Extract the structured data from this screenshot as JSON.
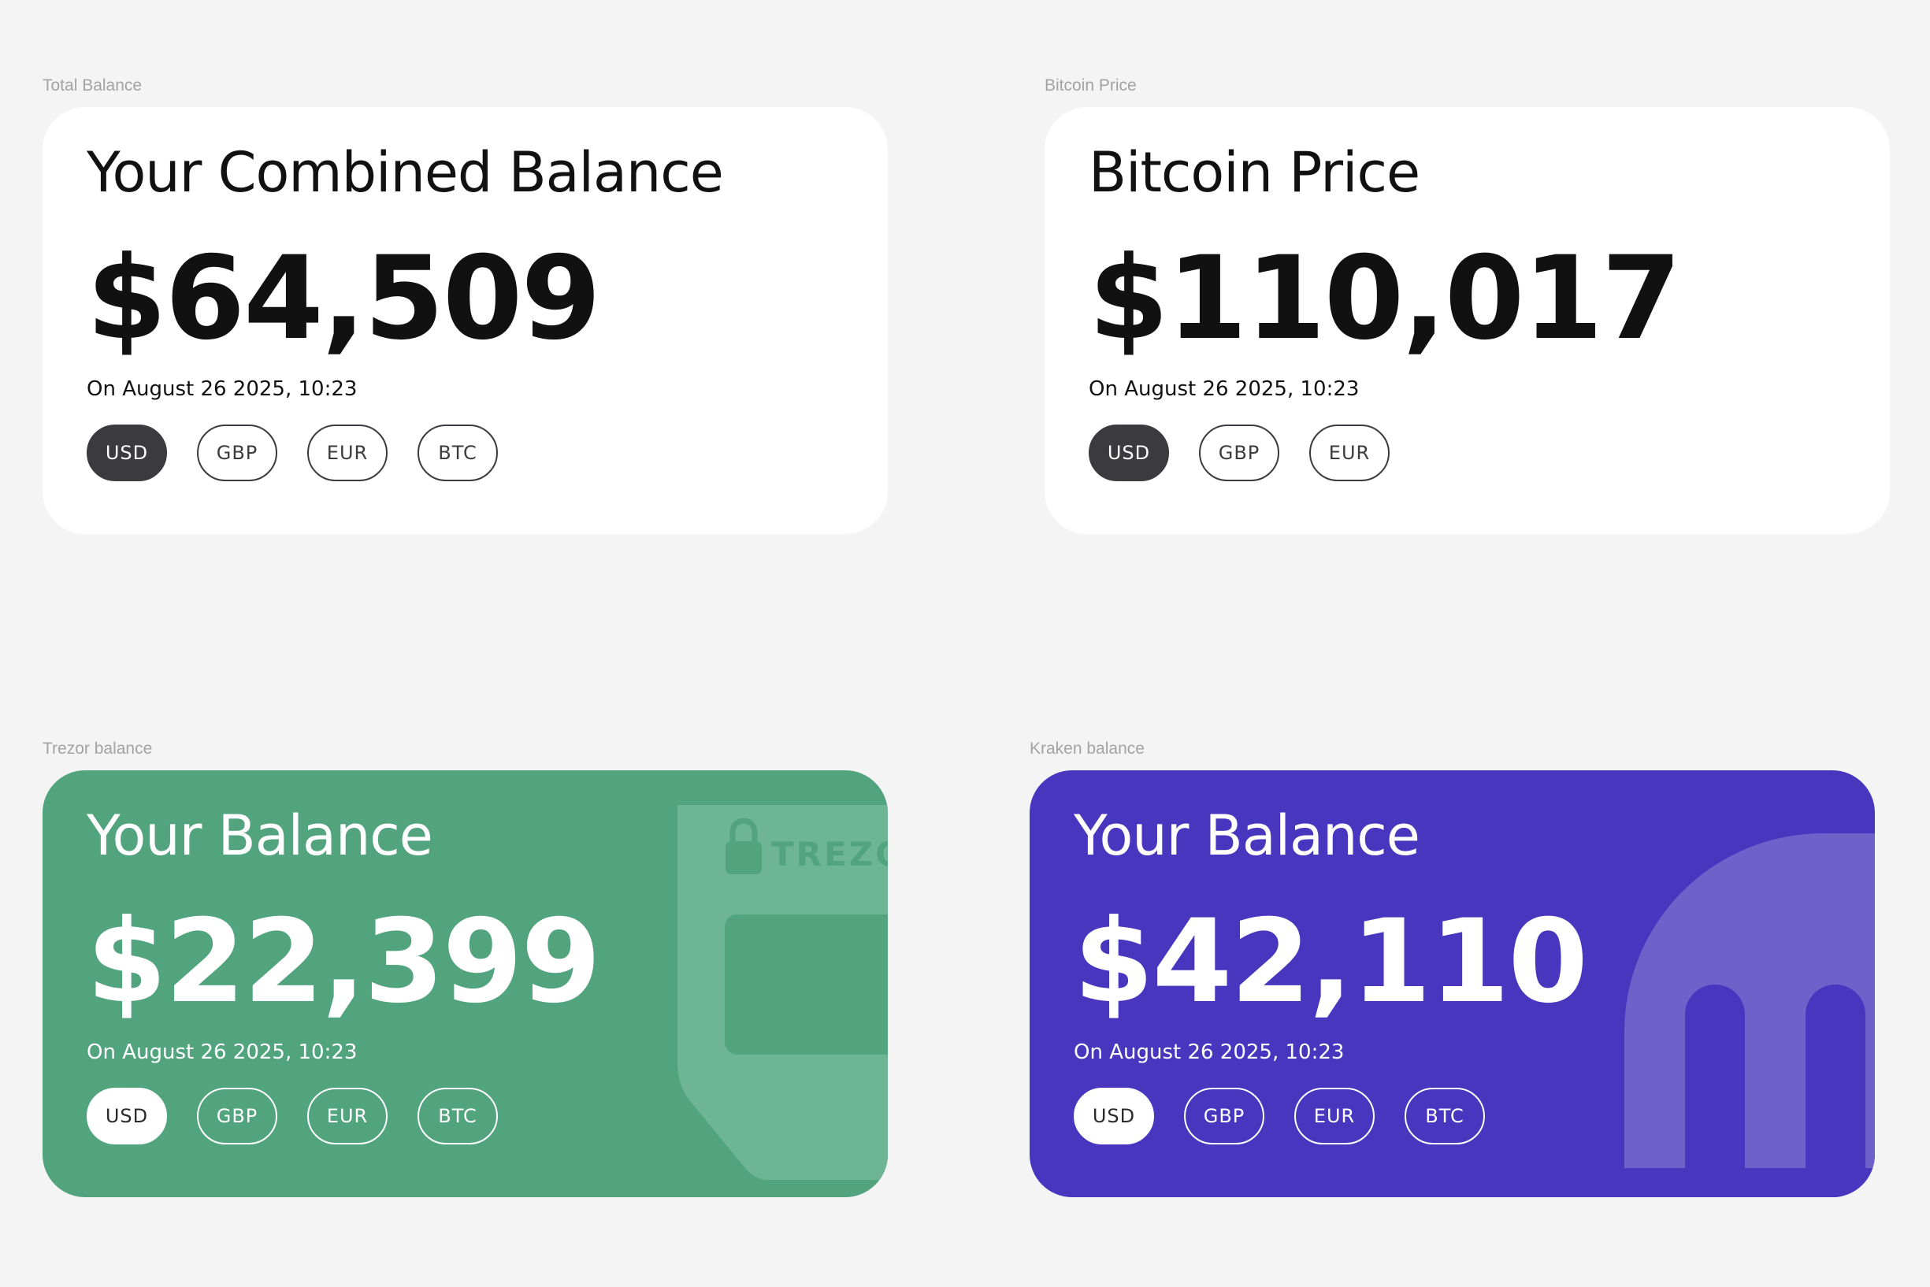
{
  "widgets": [
    {
      "caption": "Total Balance",
      "title": "Your Combined Balance",
      "amount": "$64,509",
      "date": "On August 26 2025, 10:23",
      "currencies": [
        "USD",
        "GBP",
        "EUR",
        "BTC"
      ],
      "selected_currency": "USD",
      "theme": "white",
      "background": "#ffffff"
    },
    {
      "caption": "Bitcoin Price",
      "title": "Bitcoin Price",
      "amount": "$110,017",
      "date": "On August 26 2025, 10:23",
      "currencies": [
        "USD",
        "GBP",
        "EUR"
      ],
      "selected_currency": "USD",
      "theme": "white",
      "background": "#ffffff"
    },
    {
      "caption": "Trezor balance",
      "title": "Your Balance",
      "amount": "$22,399",
      "date": "On August 26 2025, 10:23",
      "currencies": [
        "USD",
        "GBP",
        "EUR",
        "BTC"
      ],
      "selected_currency": "USD",
      "theme": "green",
      "background": "#52a47f",
      "decoration": "trezor-device-icon",
      "decoration_text": "TREZOR"
    },
    {
      "caption": "Kraken balance",
      "title": "Your Balance",
      "amount": "$42,110",
      "date": "On August 26 2025, 10:23",
      "currencies": [
        "USD",
        "GBP",
        "EUR",
        "BTC"
      ],
      "selected_currency": "USD",
      "theme": "purple",
      "background": "#4836bf",
      "decoration": "kraken-logo-icon"
    }
  ],
  "colors": {
    "page_background": "#f4f4f4",
    "active_pill_dark": "#3b3b3f",
    "caption_text": "#a3a3a3",
    "trezor_green": "#52a47f",
    "trezor_decor": "#6db595",
    "kraken_purple": "#4836bf",
    "kraken_decor": "#6f61ca"
  }
}
